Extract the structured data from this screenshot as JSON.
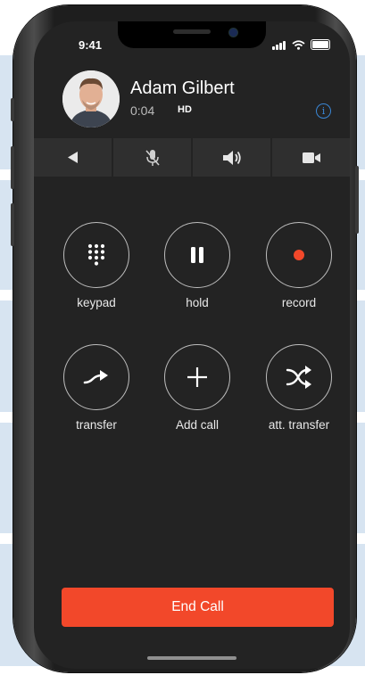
{
  "status_bar": {
    "time": "9:41"
  },
  "caller": {
    "name": "Adam Gilbert",
    "duration": "0:04",
    "quality": "HD"
  },
  "toolbar": [
    {
      "icon": "play-back-icon"
    },
    {
      "icon": "microphone-muted-icon"
    },
    {
      "icon": "speaker-icon"
    },
    {
      "icon": "video-camera-icon"
    }
  ],
  "actions": [
    {
      "label": "keypad",
      "icon": "keypad-icon"
    },
    {
      "label": "hold",
      "icon": "pause-icon"
    },
    {
      "label": "record",
      "icon": "record-icon"
    },
    {
      "label": "transfer",
      "icon": "transfer-arrow-icon"
    },
    {
      "label": "Add call",
      "icon": "plus-icon"
    },
    {
      "label": "att. transfer",
      "icon": "attended-transfer-icon"
    }
  ],
  "end_call": {
    "label": "End Call"
  },
  "colors": {
    "background_band": "#d7e4f1",
    "screen_bg": "#232323",
    "toolbar_bg": "#2f2f2f",
    "end_call": "#f2482a",
    "record_dot": "#f2482a",
    "info_accent": "#3a87d6"
  }
}
